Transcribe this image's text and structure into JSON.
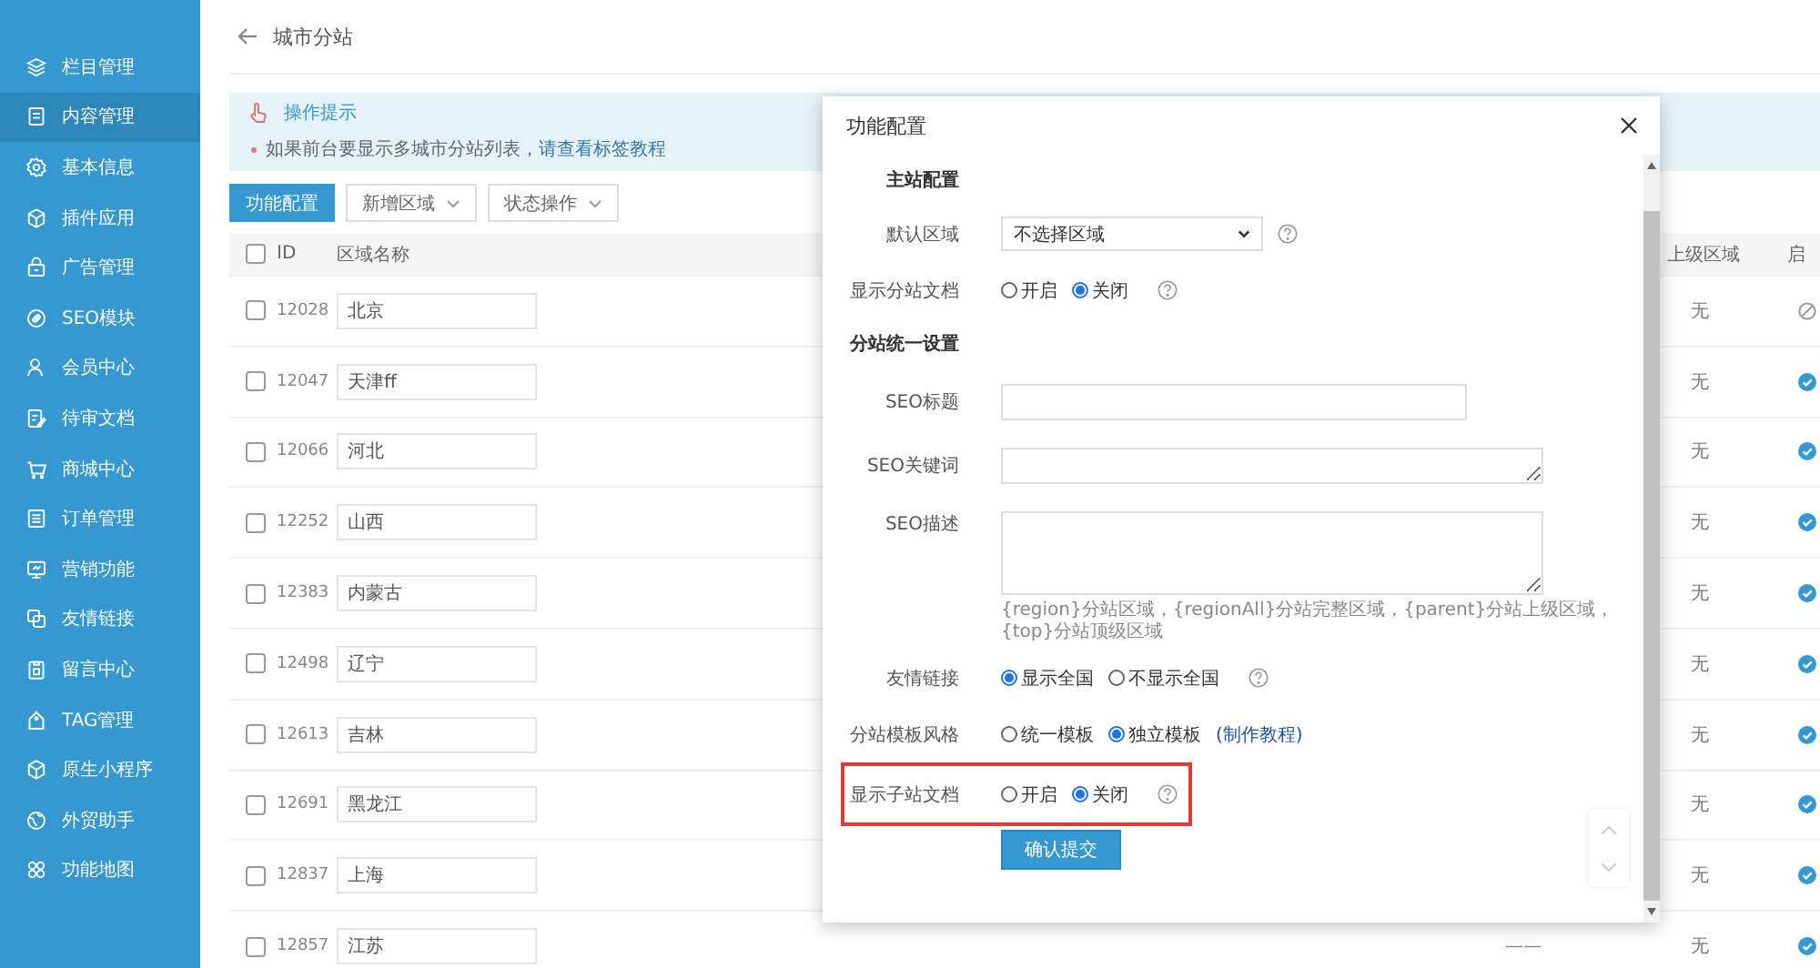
{
  "sidebar": {
    "items": [
      {
        "label": "栏目管理",
        "selected": false
      },
      {
        "label": "内容管理",
        "selected": true
      },
      {
        "label": "基本信息",
        "selected": false
      },
      {
        "label": "插件应用",
        "selected": false
      },
      {
        "label": "广告管理",
        "selected": false
      },
      {
        "label": "SEO模块",
        "selected": false
      },
      {
        "label": "会员中心",
        "selected": false
      },
      {
        "label": "待审文档",
        "selected": false
      },
      {
        "label": "商城中心",
        "selected": false
      },
      {
        "label": "订单管理",
        "selected": false
      },
      {
        "label": "营销功能",
        "selected": false
      },
      {
        "label": "友情链接",
        "selected": false
      },
      {
        "label": "留言中心",
        "selected": false
      },
      {
        "label": "TAG管理",
        "selected": false
      },
      {
        "label": "原生小程序",
        "selected": false
      },
      {
        "label": "外贸助手",
        "selected": false
      },
      {
        "label": "功能地图",
        "selected": false
      }
    ]
  },
  "page": {
    "title": "城市分站",
    "tip": {
      "title": "操作提示",
      "text": "如果前台要显示多城市分站列表，",
      "link": "请查看标签教程"
    },
    "toolbar": [
      {
        "label": "功能配置",
        "kind": "primary"
      },
      {
        "label": "新增区域",
        "kind": "dropdown"
      },
      {
        "label": "状态操作",
        "kind": "dropdown"
      }
    ],
    "table": {
      "select_all": false,
      "columns": [
        "ID",
        "区域名称",
        "上级区域",
        "启"
      ],
      "rows": [
        {
          "checked": false,
          "id": "12028",
          "name": "北京",
          "parent": "无",
          "enabled": false
        },
        {
          "checked": false,
          "id": "12047",
          "name": "天津ff",
          "parent": "无",
          "enabled": true
        },
        {
          "checked": false,
          "id": "12066",
          "name": "河北",
          "parent": "无",
          "enabled": true
        },
        {
          "checked": false,
          "id": "12252",
          "name": "山西",
          "parent": "无",
          "enabled": true
        },
        {
          "checked": false,
          "id": "12383",
          "name": "内蒙古",
          "parent": "无",
          "enabled": true
        },
        {
          "checked": false,
          "id": "12498",
          "name": "辽宁",
          "parent": "无",
          "enabled": true
        },
        {
          "checked": false,
          "id": "12613",
          "name": "吉林",
          "parent": "无",
          "enabled": true
        },
        {
          "checked": false,
          "id": "12691",
          "name": "黑龙江",
          "parent": "无",
          "enabled": true
        },
        {
          "checked": false,
          "id": "12837",
          "name": "上海",
          "parent": "无",
          "enabled": true
        },
        {
          "checked": false,
          "id": "12857",
          "name": "江苏",
          "parent": "无",
          "enabled": true,
          "column_3": "——"
        }
      ]
    }
  },
  "dialog": {
    "title": "功能配置",
    "fields": [
      {
        "kind": "section",
        "label": "主站配置"
      },
      {
        "kind": "select",
        "label": "默认区域",
        "value": "不选择区域",
        "help": true
      },
      {
        "kind": "radio",
        "label": "显示分站文档",
        "options": [
          {
            "label": "开启",
            "selected": false
          },
          {
            "label": "关闭",
            "selected": true
          }
        ],
        "help": true
      },
      {
        "kind": "section",
        "label": "分站统一设置"
      },
      {
        "kind": "text",
        "label": "SEO标题"
      },
      {
        "kind": "textarea",
        "label": "SEO关键词"
      },
      {
        "kind": "memo",
        "label": "SEO描述"
      },
      {
        "kind": "hint",
        "text": "{region}分站区域，{regionAll}分站完整区域，{parent}分站上级区域，{top}分站顶级区域"
      },
      {
        "kind": "radio",
        "label": "友情链接",
        "options": [
          {
            "label": "显示全国",
            "selected": true
          },
          {
            "label": "不显示全国",
            "selected": false
          }
        ],
        "help": true
      },
      {
        "kind": "radio",
        "label": "分站模板风格",
        "options": [
          {
            "label": "统一模板",
            "selected": false
          },
          {
            "label": "独立模板",
            "selected": true
          }
        ],
        "link": "(制作教程)"
      },
      {
        "kind": "radio",
        "label": "显示子站文档",
        "options": [
          {
            "label": "开启",
            "selected": false
          },
          {
            "label": "关闭",
            "selected": true
          }
        ],
        "help": true,
        "highlighted": true
      }
    ],
    "submit": "确认提交"
  }
}
